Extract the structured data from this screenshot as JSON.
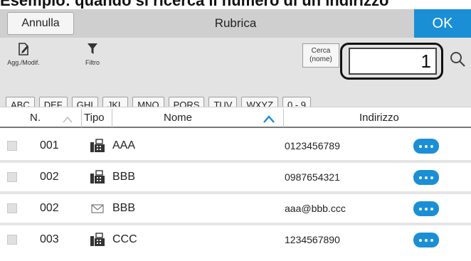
{
  "caption": "Esempio: quando si ricerca il numero di un indirizzo",
  "titlebar": {
    "cancel_label": "Annulla",
    "title": "Rubrica",
    "ok_label": "OK",
    "accent_color": "#1a8fd6"
  },
  "toolbar": {
    "edit_label": "Agg./Modif.",
    "edit_icon": "edit-document-icon",
    "filter_label": "Filtro",
    "filter_icon": "funnel-icon",
    "search_type_line1": "Cerca",
    "search_type_line2": "(nome)",
    "search_value": "1",
    "search_icon": "magnifier-icon"
  },
  "index_tabs": [
    "ABC",
    "DEF",
    "GHI",
    "JKL",
    "MNO",
    "PQRS",
    "TUV",
    "WXYZ",
    "0 - 9"
  ],
  "table": {
    "headers": {
      "number": "N.",
      "type": "Tipo",
      "name": "Nome",
      "address": "Indirizzo"
    },
    "rows": [
      {
        "number": "001",
        "type_icon": "fax-icon",
        "name": "AAA",
        "address": "0123456789"
      },
      {
        "number": "002",
        "type_icon": "fax-icon",
        "name": "BBB",
        "address": "0987654321"
      },
      {
        "number": "002",
        "type_icon": "email-icon",
        "name": "BBB",
        "address": "aaa@bbb.ccc"
      },
      {
        "number": "003",
        "type_icon": "fax-icon",
        "name": "CCC",
        "address": "1234567890"
      }
    ]
  }
}
